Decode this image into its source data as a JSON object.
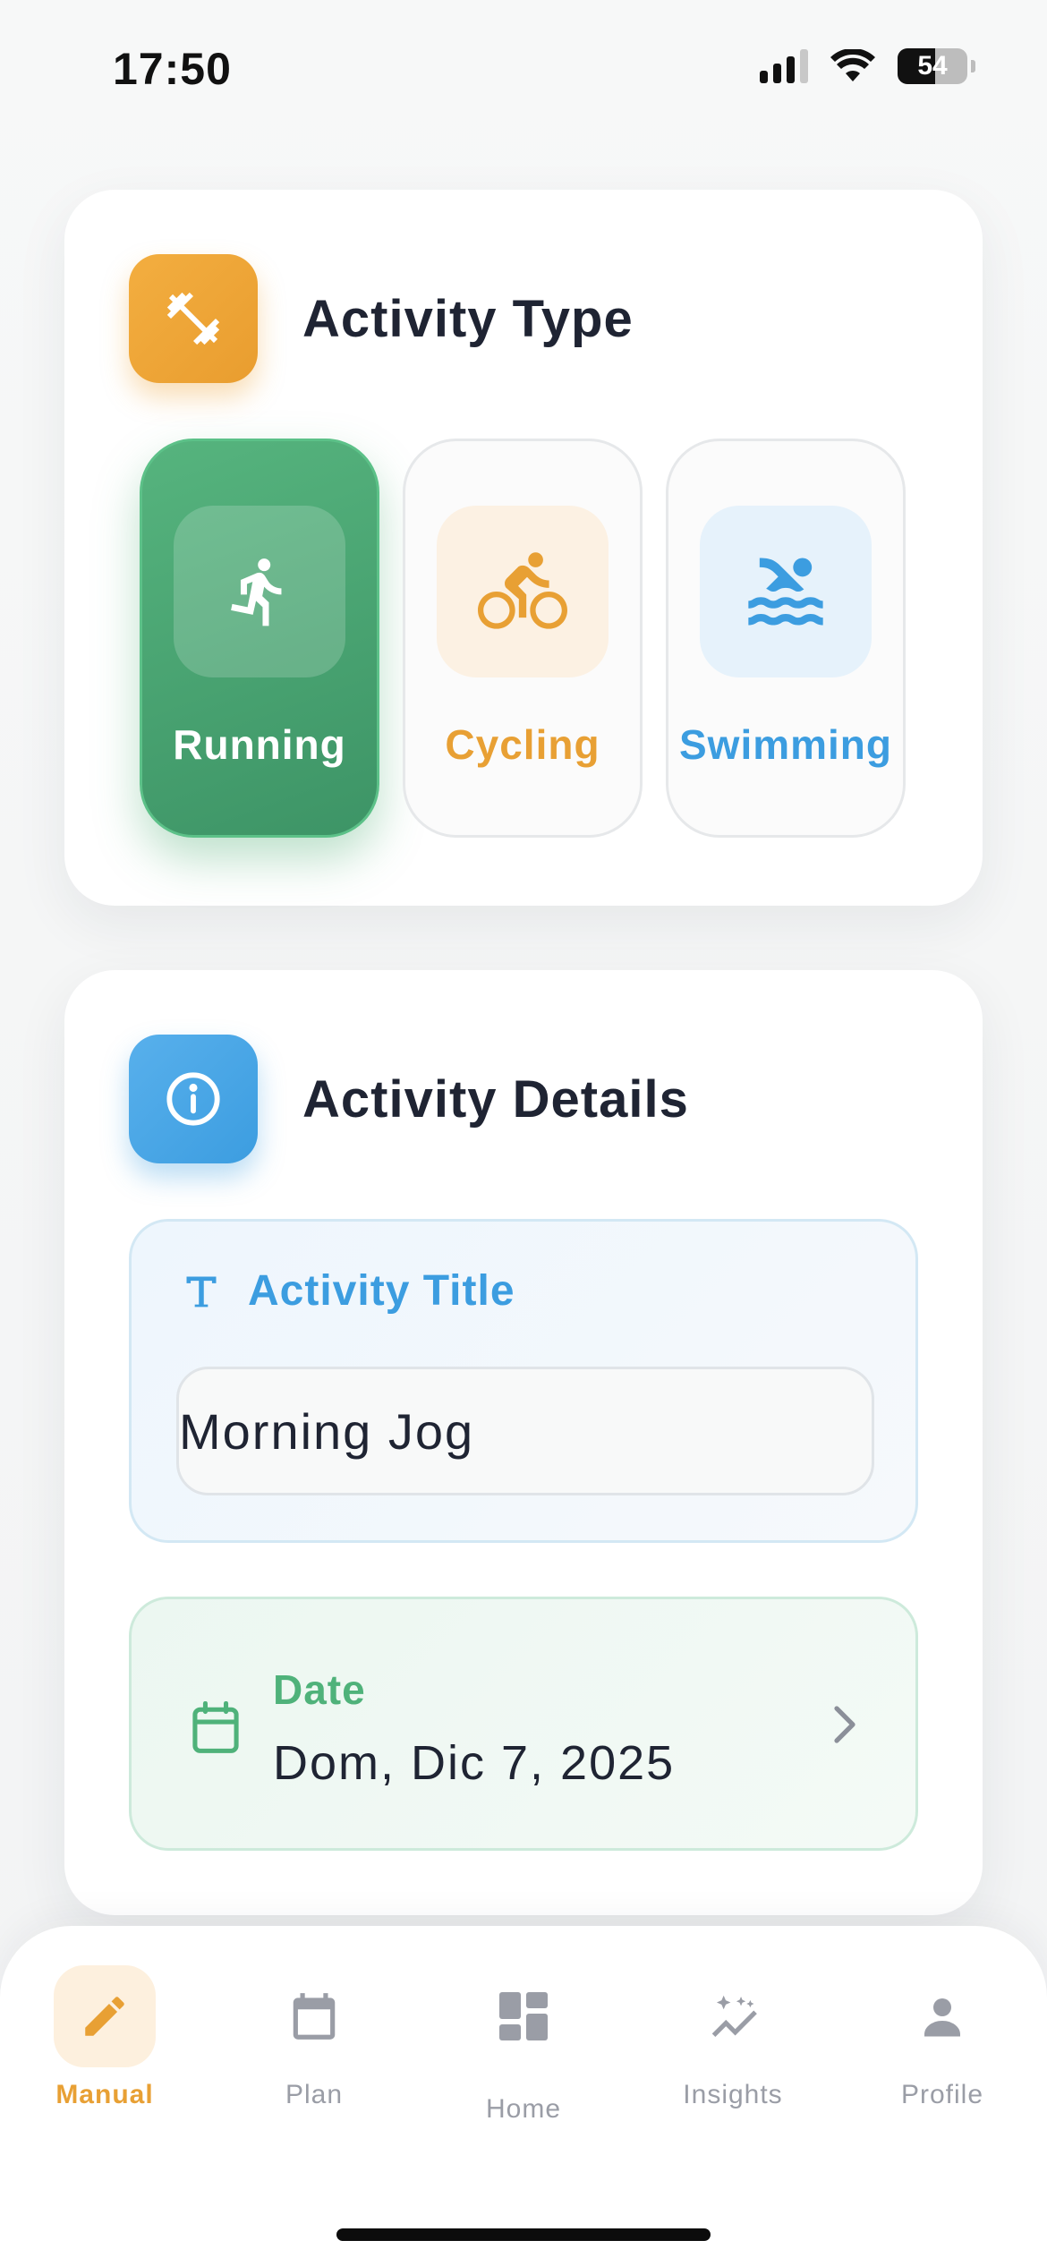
{
  "status_bar": {
    "time": "17:50",
    "battery": "54"
  },
  "activity_type": {
    "title": "Activity Type",
    "header_icon": "dumbbell-icon",
    "accent": "#EBA036",
    "options": [
      {
        "label": "Running",
        "icon": "running-icon",
        "color": "#4CAF78",
        "selected": true
      },
      {
        "label": "Cycling",
        "icon": "bicycle-icon",
        "color": "#E8A034",
        "selected": false
      },
      {
        "label": "Swimming",
        "icon": "swimming-icon",
        "color": "#3C9DE0",
        "selected": false
      }
    ]
  },
  "activity_details": {
    "title": "Activity Details",
    "header_icon": "info-icon",
    "accent": "#3C9DE0",
    "title_field": {
      "label": "Activity Title",
      "icon": "text-icon",
      "value": "Morning Jog"
    },
    "date_field": {
      "label": "Date",
      "icon": "calendar-icon",
      "value": "Dom, Dic 7, 2025"
    }
  },
  "bottom_nav": {
    "items": [
      {
        "label": "Manual",
        "icon": "pencil-icon",
        "active": true
      },
      {
        "label": "Plan",
        "icon": "calendar-icon",
        "active": false
      },
      {
        "label": "Home",
        "icon": "dashboard-icon",
        "active": false
      },
      {
        "label": "Insights",
        "icon": "sparkle-chart-icon",
        "active": false
      },
      {
        "label": "Profile",
        "icon": "person-icon",
        "active": false
      }
    ]
  }
}
